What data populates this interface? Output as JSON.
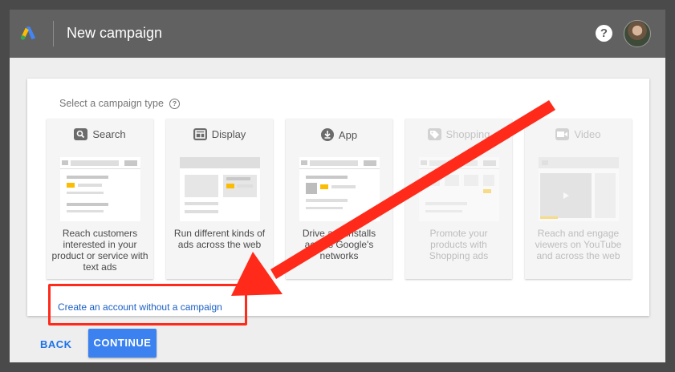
{
  "header": {
    "title": "New campaign",
    "help_label": "?"
  },
  "main": {
    "select_label": "Select a campaign type",
    "help_outline": "?",
    "campaign_types": [
      {
        "label": "Search",
        "description": "Reach customers interested in your product or service with text ads",
        "icon": "search-icon",
        "disabled": false
      },
      {
        "label": "Display",
        "description": "Run different kinds of ads across the web",
        "icon": "display-icon",
        "disabled": false
      },
      {
        "label": "App",
        "description": "Drive app installs across Google's networks",
        "icon": "download-icon",
        "disabled": false
      },
      {
        "label": "Shopping",
        "description": "Promote your products with Shopping ads",
        "icon": "tag-icon",
        "disabled": true
      },
      {
        "label": "Video",
        "description": "Reach and engage viewers on YouTube and across the web",
        "icon": "video-camera-icon",
        "disabled": true
      }
    ],
    "create_account_link": "Create an account without a campaign"
  },
  "footer": {
    "back_label": "BACK",
    "continue_label": "CONTINUE"
  },
  "colors": {
    "topbar": "#616161",
    "primary": "#3b82f0",
    "link": "#1a5fc4",
    "annotation": "#ff2a1a",
    "accent_yellow": "#fbbc04"
  }
}
